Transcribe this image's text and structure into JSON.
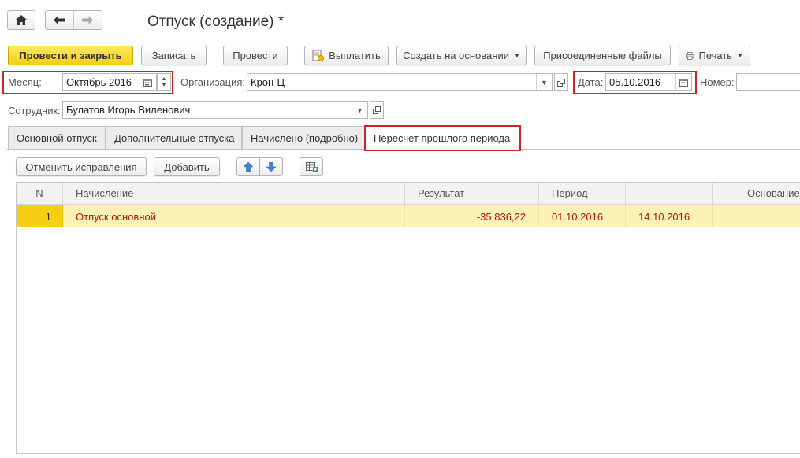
{
  "window": {
    "title": "Отпуск (создание) *"
  },
  "toolbar": {
    "post_and_close": "Провести и закрыть",
    "save": "Записать",
    "post": "Провести",
    "pay": "Выплатить",
    "create_based_on": "Создать на основании",
    "attached_files": "Присоединенные файлы",
    "print": "Печать"
  },
  "header": {
    "month_label": "Месяц:",
    "month_value": "Октябрь 2016",
    "organization_label": "Организация:",
    "organization_value": "Крон-Ц",
    "date_label": "Дата:",
    "date_value": "05.10.2016",
    "number_label": "Номер:",
    "number_value": "",
    "employee_label": "Сотрудник:",
    "employee_value": "Булатов Игорь Виленович"
  },
  "tabs": [
    {
      "label": "Основной отпуск"
    },
    {
      "label": "Дополнительные отпуска"
    },
    {
      "label": "Начислено (подробно)"
    },
    {
      "label": "Пересчет прошлого периода",
      "active": true
    }
  ],
  "grid_toolbar": {
    "cancel_corrections": "Отменить исправления",
    "add": "Добавить"
  },
  "table": {
    "columns": [
      "N",
      "Начисление",
      "Результат",
      "Период",
      "",
      "Основание"
    ],
    "rows": [
      {
        "n": "1",
        "accrual": "Отпуск основной",
        "result": "-35 836,22",
        "period_start": "01.10.2016",
        "period_end": "14.10.2016",
        "basis": ""
      }
    ]
  },
  "colors": {
    "primary_button": "#f4cf12",
    "highlight_box": "#d2202a",
    "selected_row": "#fbf2b4",
    "row_text": "#b3141a"
  }
}
